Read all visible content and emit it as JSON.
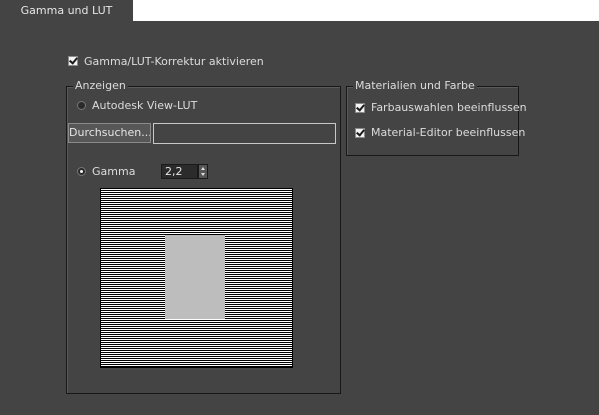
{
  "tab": {
    "label": "Gamma und LUT"
  },
  "enable": {
    "label": "Gamma/LUT-Korrektur aktivieren",
    "checked": true
  },
  "display_group": {
    "legend": "Anzeigen",
    "lut_option": {
      "label": "Autodesk View-LUT",
      "selected": false
    },
    "browse_label": "Durchsuchen...",
    "path_value": "",
    "gamma_option": {
      "label": "Gamma",
      "selected": true
    },
    "gamma_value": "2,2"
  },
  "materials_group": {
    "legend": "Materialien und Farbe",
    "items": [
      {
        "label": "Farbauswahlen beeinflussen",
        "checked": true
      },
      {
        "label": "Material-Editor beeinflussen",
        "checked": true
      }
    ]
  },
  "colors": {
    "background": "#444444",
    "tab_bar": "#ffffff",
    "text": "#dcdcdc"
  }
}
